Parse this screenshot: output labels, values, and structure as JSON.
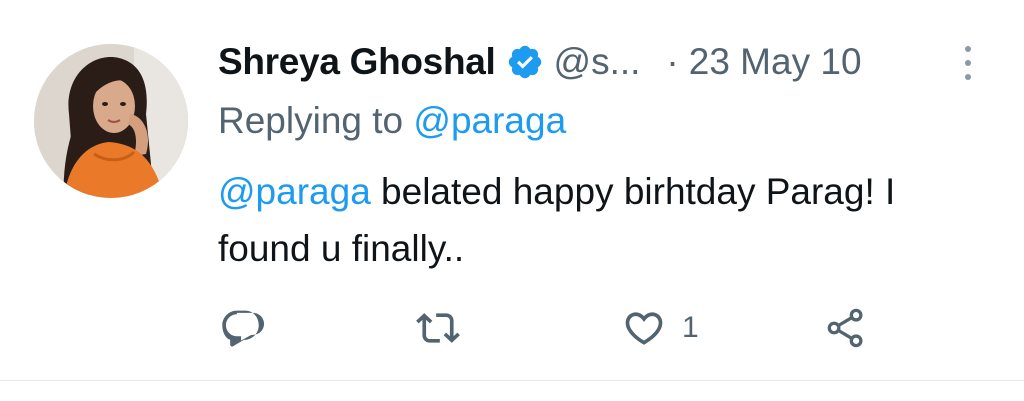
{
  "tweet": {
    "author_name": "Shreya Ghoshal",
    "handle": "@s...",
    "separator": "·",
    "date": "23 May 10",
    "replying_prefix": "Replying to ",
    "replying_to": "@paraga",
    "body_mention": "@paraga",
    "body_text": " belated happy birhtday Parag! I found u finally..",
    "verified": true
  },
  "actions": {
    "reply_icon": "reply-icon",
    "retweet_icon": "retweet-icon",
    "like_icon": "like-icon",
    "like_count": "1",
    "share_icon": "share-icon"
  },
  "colors": {
    "accent": "#1d9bf0",
    "text_primary": "#0f1419",
    "text_secondary": "#536471"
  }
}
